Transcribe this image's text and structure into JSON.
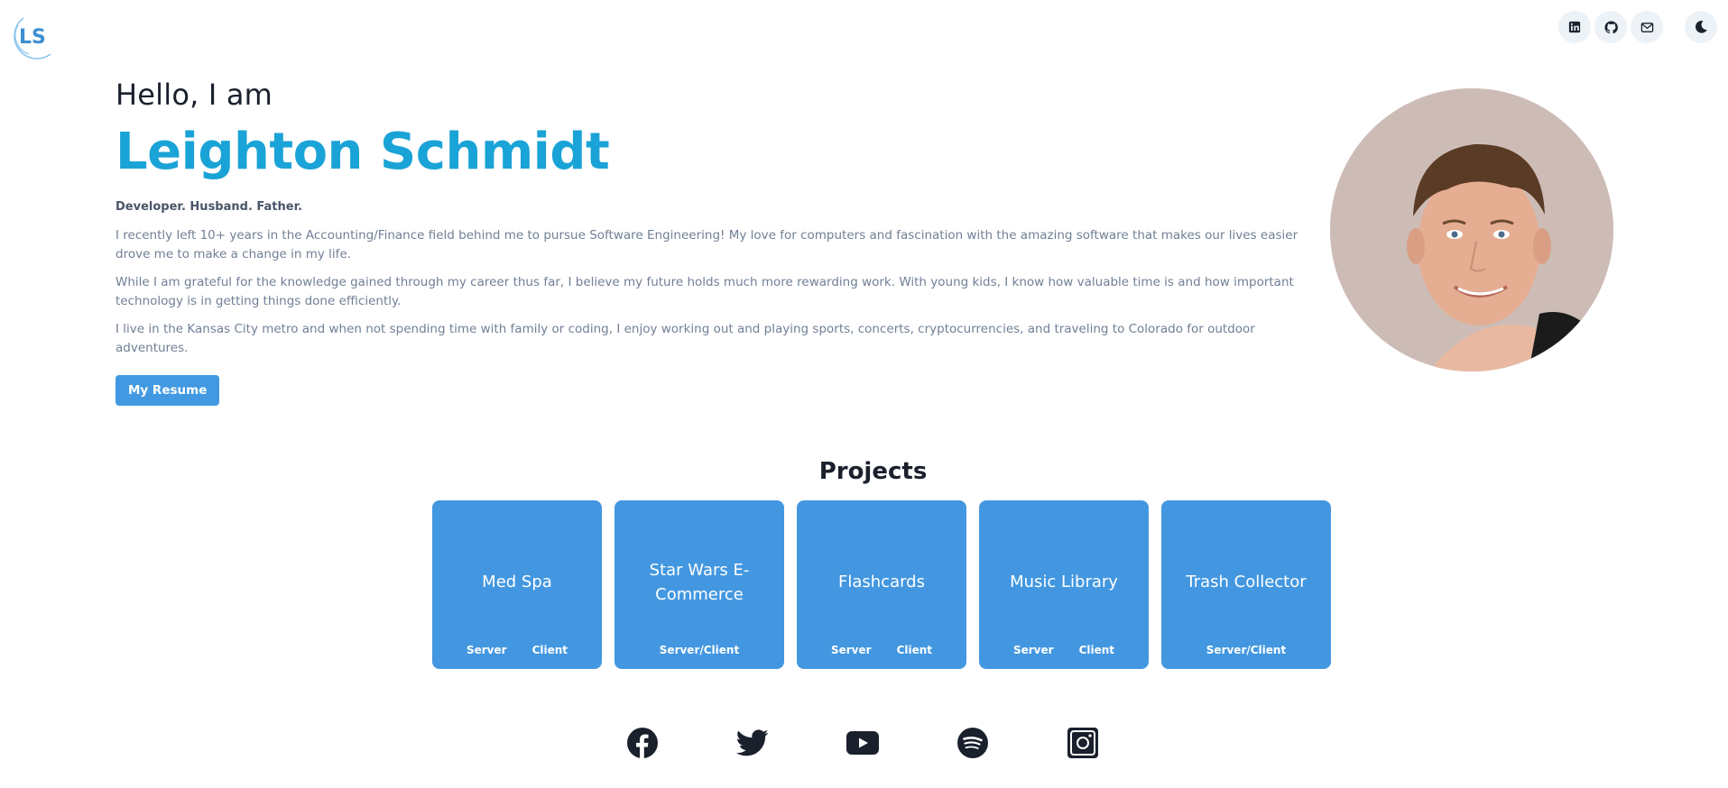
{
  "logo": {
    "text": "LS"
  },
  "header": {
    "icons": [
      "linkedin-icon",
      "github-icon",
      "mail-icon"
    ],
    "theme_icon": "moon-icon"
  },
  "hero": {
    "greeting": "Hello, I am",
    "name": "Leighton Schmidt",
    "tagline": "Developer. Husband. Father.",
    "paragraphs": [
      "I recently left 10+ years in the Accounting/Finance field behind me to pursue Software Engineering! My love for computers and fascination with the amazing software that makes our lives easier drove me to make a change in my life.",
      "While I am grateful for the knowledge gained through my career thus far, I believe my future holds much more rewarding work. With young kids, I know how valuable time is and how important technology is in getting things done efficiently.",
      "I live in the Kansas City metro and when not spending time with family or coding, I enjoy working out and playing sports, concerts, cryptocurrencies, and traveling to Colorado for outdoor adventures."
    ],
    "resume_label": "My Resume"
  },
  "projects": {
    "title": "Projects",
    "items": [
      {
        "title": "Med Spa",
        "links": [
          "Server",
          "Client"
        ]
      },
      {
        "title": "Star Wars E-Commerce",
        "links": [
          "Server/Client"
        ]
      },
      {
        "title": "Flashcards",
        "links": [
          "Server",
          "Client"
        ]
      },
      {
        "title": "Music Library",
        "links": [
          "Server",
          "Client"
        ]
      },
      {
        "title": "Trash Collector",
        "links": [
          "Server/Client"
        ]
      }
    ]
  },
  "social": [
    "facebook-icon",
    "twitter-icon",
    "youtube-icon",
    "spotify-icon",
    "instagram-icon"
  ],
  "colors": {
    "accent": "#1aa3d6",
    "button": "#4299e1",
    "card": "#4397e0",
    "text_muted": "#718096"
  }
}
